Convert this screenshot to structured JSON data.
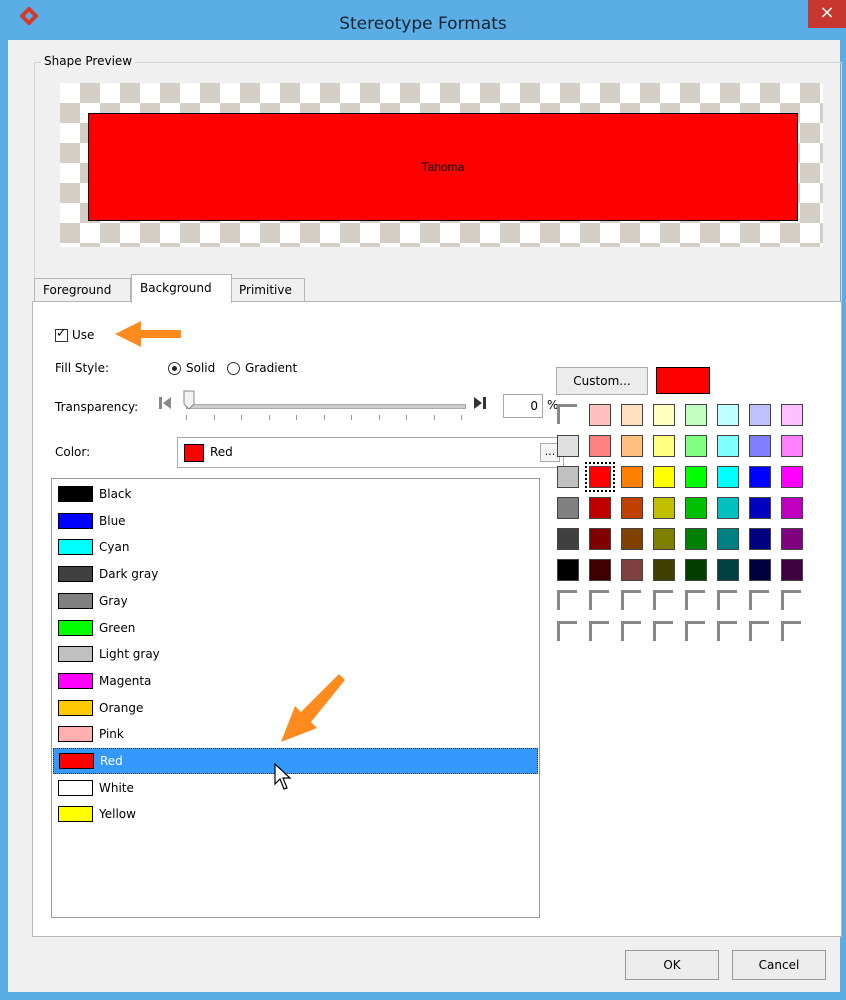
{
  "window": {
    "title": "Stereotype Formats",
    "close_glyph": "×"
  },
  "preview": {
    "legend": "Shape Preview",
    "shape_text": "Tahoma"
  },
  "tabs": [
    {
      "label": "Foreground"
    },
    {
      "label": "Background"
    },
    {
      "label": "Primitive"
    }
  ],
  "background_tab": {
    "use_label": "Use",
    "use_checked": true,
    "fill_style_label": "Fill Style:",
    "solid_label": "Solid",
    "gradient_label": "Gradient",
    "transparency_label": "Transparency:",
    "transparency_value": "0",
    "transparency_unit": "%",
    "color_label": "Color:",
    "color_value": "Red",
    "ellipsis": "...",
    "custom_label": "Custom...",
    "colors": [
      {
        "name": "Black",
        "hex": "#000000"
      },
      {
        "name": "Blue",
        "hex": "#0000ff"
      },
      {
        "name": "Cyan",
        "hex": "#00ffff"
      },
      {
        "name": "Dark gray",
        "hex": "#404040"
      },
      {
        "name": "Gray",
        "hex": "#808080"
      },
      {
        "name": "Green",
        "hex": "#00ff00"
      },
      {
        "name": "Light gray",
        "hex": "#c0c0c0"
      },
      {
        "name": "Magenta",
        "hex": "#ff00ff"
      },
      {
        "name": "Orange",
        "hex": "#ffc800"
      },
      {
        "name": "Pink",
        "hex": "#ffafaf"
      },
      {
        "name": "Red",
        "hex": "#ff0000",
        "selected": true
      },
      {
        "name": "White",
        "hex": "#ffffff"
      },
      {
        "name": "Yellow",
        "hex": "#ffff00"
      }
    ],
    "palette": [
      [
        "",
        "#ffc0c0",
        "#ffe0c0",
        "#ffffc0",
        "#c0ffc0",
        "#c0ffff",
        "#c0c0ff",
        "#ffc0ff"
      ],
      [
        "#e0e0e0",
        "#ff8080",
        "#ffc080",
        "#ffff80",
        "#80ff80",
        "#80ffff",
        "#8080ff",
        "#ff80ff"
      ],
      [
        "#c0c0c0",
        "#ff0000",
        "#ff8000",
        "#ffff00",
        "#00ff00",
        "#00ffff",
        "#0000ff",
        "#ff00ff"
      ],
      [
        "#808080",
        "#c00000",
        "#c04000",
        "#c0c000",
        "#00c000",
        "#00c0c0",
        "#0000c0",
        "#c000c0"
      ],
      [
        "#404040",
        "#800000",
        "#804000",
        "#808000",
        "#008000",
        "#008080",
        "#000080",
        "#800080"
      ],
      [
        "#000000",
        "#400000",
        "#804040",
        "#404000",
        "#004000",
        "#004040",
        "#000040",
        "#400040"
      ],
      [
        "",
        "",
        "",
        "",
        "",
        "",
        "",
        ""
      ],
      [
        "",
        "",
        "",
        "",
        "",
        "",
        "",
        ""
      ]
    ]
  },
  "footer": {
    "ok_label": "OK",
    "cancel_label": "Cancel"
  },
  "colors": {
    "accent_arrow": "#ff8a1d",
    "selection": "#3399ff",
    "titlebar": "#5aaee5"
  }
}
